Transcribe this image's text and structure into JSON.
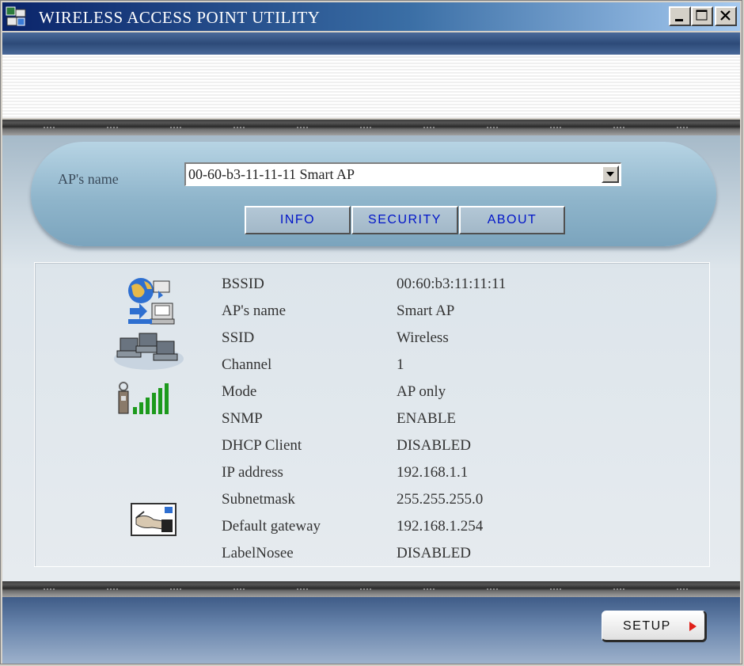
{
  "window": {
    "title": "WIRELESS ACCESS POINT UTILITY",
    "icon": "network-app-icon",
    "controls": [
      "minimize-icon",
      "maximize-icon",
      "close-icon"
    ]
  },
  "selector": {
    "label": "AP's name",
    "selected": "00-60-b3-11-11-11 Smart AP"
  },
  "tabs": [
    {
      "label": "INFO"
    },
    {
      "label": "SECURITY"
    },
    {
      "label": "ABOUT"
    }
  ],
  "info": {
    "rows": [
      {
        "label": "BSSID",
        "value": "00:60:b3:11:11:11"
      },
      {
        "label": "AP's name",
        "value": "Smart AP"
      },
      {
        "label": "SSID",
        "value": "Wireless"
      },
      {
        "label": "Channel",
        "value": "1"
      },
      {
        "label": "Mode",
        "value": "AP only"
      },
      {
        "label": "SNMP",
        "value": "ENABLE"
      },
      {
        "label": "DHCP Client",
        "value": "DISABLED"
      },
      {
        "label": "IP address",
        "value": "192.168.1.1"
      },
      {
        "label": "Subnetmask",
        "value": "255.255.255.0"
      },
      {
        "label": "Default gateway",
        "value": "192.168.1.254"
      },
      {
        "label": "LabelNosee",
        "value": "DISABLED"
      }
    ],
    "icons": [
      "globe-network-icon",
      "computers-icon",
      "signal-strength-icon",
      "card-settings-icon"
    ]
  },
  "footer": {
    "setup_label": "SETUP"
  },
  "colors": {
    "tab_text": "#0014c8",
    "setup_arrow": "#e0201a",
    "signal_green": "#1c9a1c"
  }
}
